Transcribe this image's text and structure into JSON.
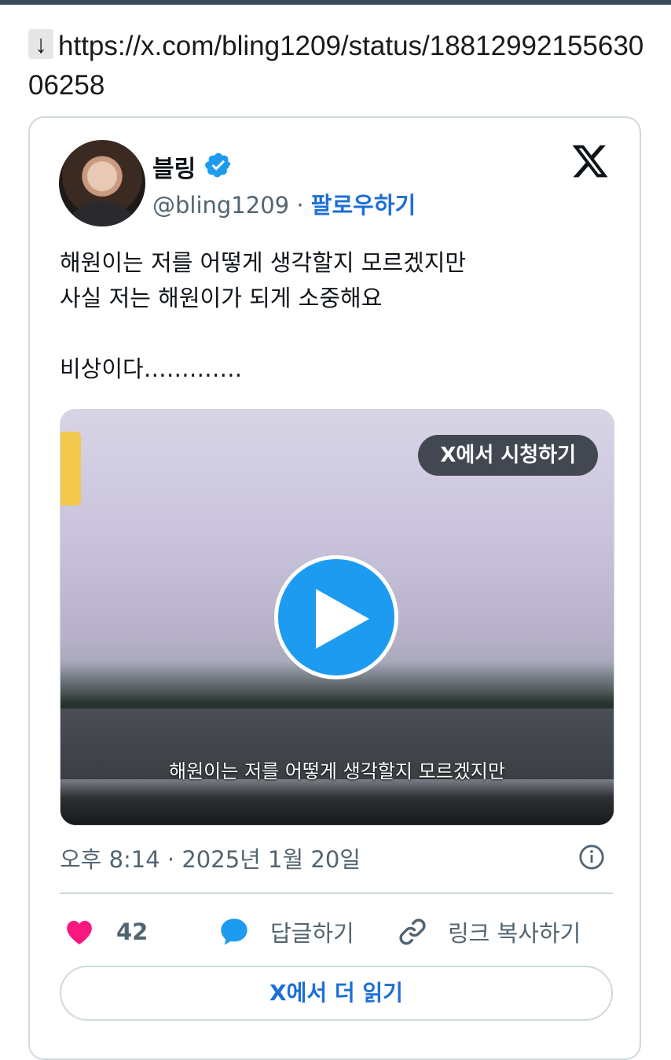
{
  "header": {
    "arrow": "↓",
    "url": "https://x.com/bling1209/status/1881299215563006258"
  },
  "tweet": {
    "author_name": "블링",
    "handle": "@bling1209",
    "separator": " · ",
    "follow_label": "팔로우하기",
    "text": "해원이는 저를 어떻게 생각할지 모르겠지만\n사실 저는 해원이가 되게 소중해요\n\n비상이다………….",
    "media": {
      "watch_label": "X에서 시청하기",
      "subtitle": "해원이는 저를 어떻게 생각할지 모르겠지만"
    },
    "timestamp": "오후 8:14 · 2025년 1월 20일",
    "likes": "42",
    "reply_label": "답글하기",
    "copy_link_label": "링크 복사하기",
    "read_more_label": "X에서 더 읽기"
  },
  "colors": {
    "accent": "#1d9bf0",
    "link": "#1d6fd6",
    "like": "#f91880",
    "muted": "#536471",
    "border": "#cfd9de"
  },
  "icons": [
    "verified-badge-icon",
    "x-logo-icon",
    "play-icon",
    "info-icon",
    "heart-icon",
    "reply-bubble-icon",
    "link-icon"
  ]
}
